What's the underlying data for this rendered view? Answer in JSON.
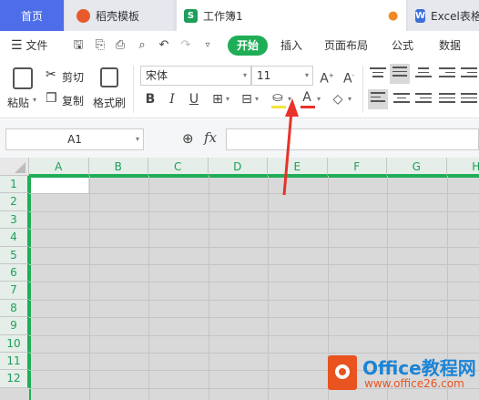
{
  "tabs": {
    "home": "首页",
    "doc": "稻壳模板",
    "workbook": "工作簿1",
    "excel": "Excel表格",
    "doc_icon": "docer-icon",
    "sheet_icon": "S",
    "word_icon": "W"
  },
  "menu": {
    "file": "文件",
    "start": "开始",
    "insert": "插入",
    "page_layout": "页面布局",
    "formula": "公式",
    "data": "数据"
  },
  "toolbar": {
    "paste": "粘贴",
    "cut": "剪切",
    "copy": "复制",
    "format_painter": "格式刷",
    "font_name": "宋体",
    "font_size": "11",
    "bold": "B",
    "italic": "I",
    "underline": "U"
  },
  "formula_bar": {
    "cell_ref": "A1",
    "fx": "fx",
    "value": ""
  },
  "sheet": {
    "columns": [
      "A",
      "B",
      "C",
      "D",
      "E",
      "F",
      "G",
      "H"
    ],
    "rows": [
      "1",
      "2",
      "3",
      "4",
      "5",
      "6",
      "7",
      "8",
      "9",
      "10",
      "11",
      "12"
    ]
  },
  "watermark": {
    "title": "Office教程网",
    "url": "www.office26.com"
  },
  "colors": {
    "accent_green": "#1fae57",
    "home_tab_blue": "#4d6ee8",
    "arrow_red": "#e8322a"
  }
}
